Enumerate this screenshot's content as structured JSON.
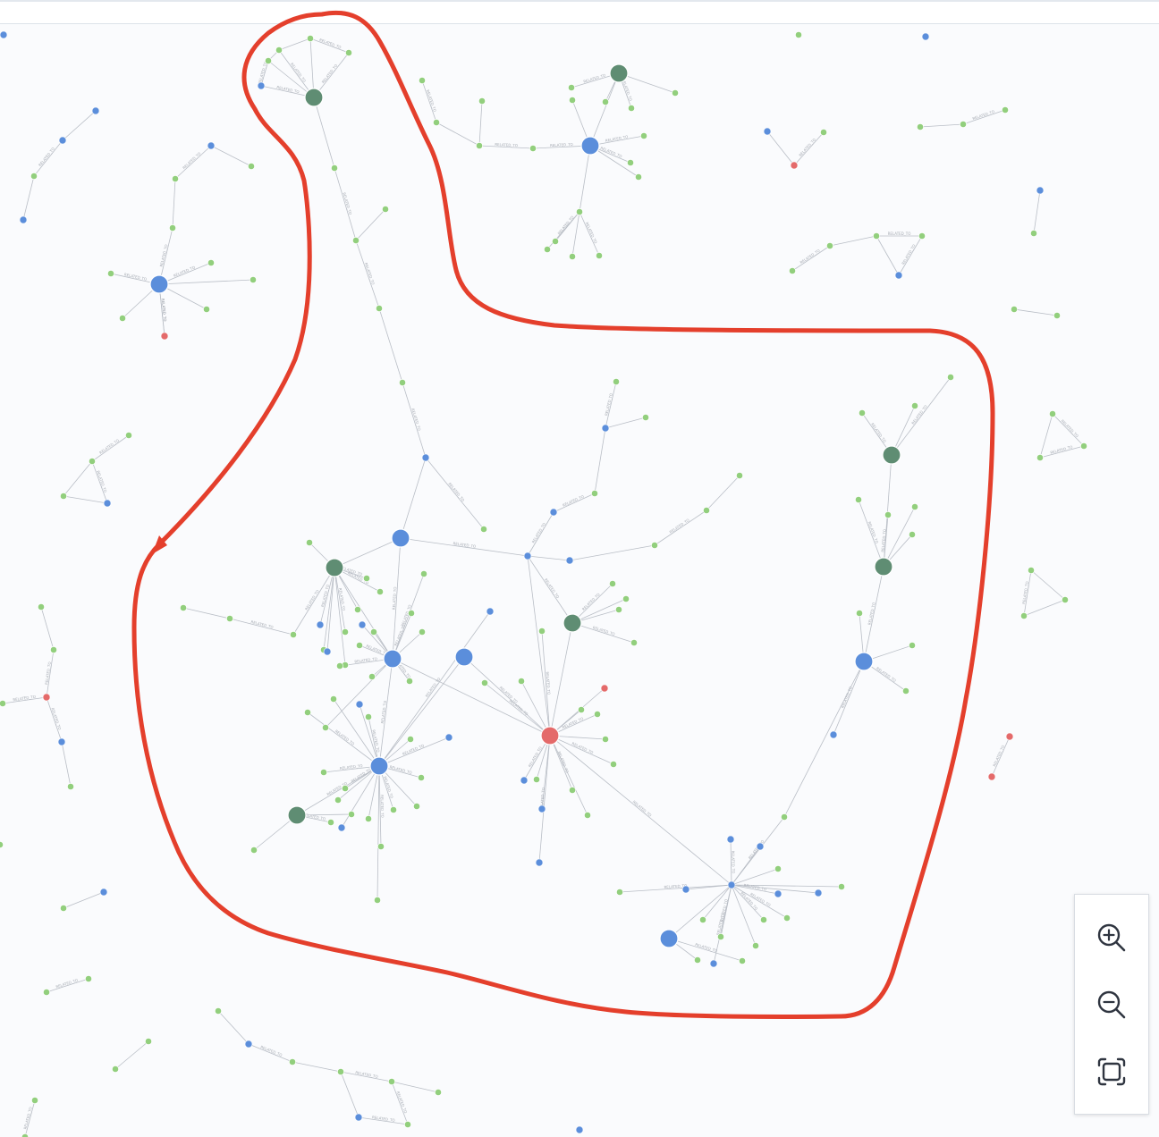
{
  "controls": {
    "zoom_in_label": "Zoom in",
    "zoom_out_label": "Zoom out",
    "fit_label": "Fit to screen",
    "zoom_in_icon": "zoom-in-icon",
    "zoom_out_icon": "zoom-out-icon",
    "fit_icon": "fit-screen-icon"
  },
  "colors": {
    "highlight": "#e43f2c",
    "node_blue": "#5b8edb",
    "node_green_large": "#5f8d73",
    "node_green_small": "#92cf7d",
    "node_red": "#e46a6a",
    "edge": "#b9bec6"
  },
  "graph": {
    "edge_label": "RELATED_TO",
    "node_types": [
      "blue",
      "green",
      "red",
      "darkgreen"
    ]
  }
}
